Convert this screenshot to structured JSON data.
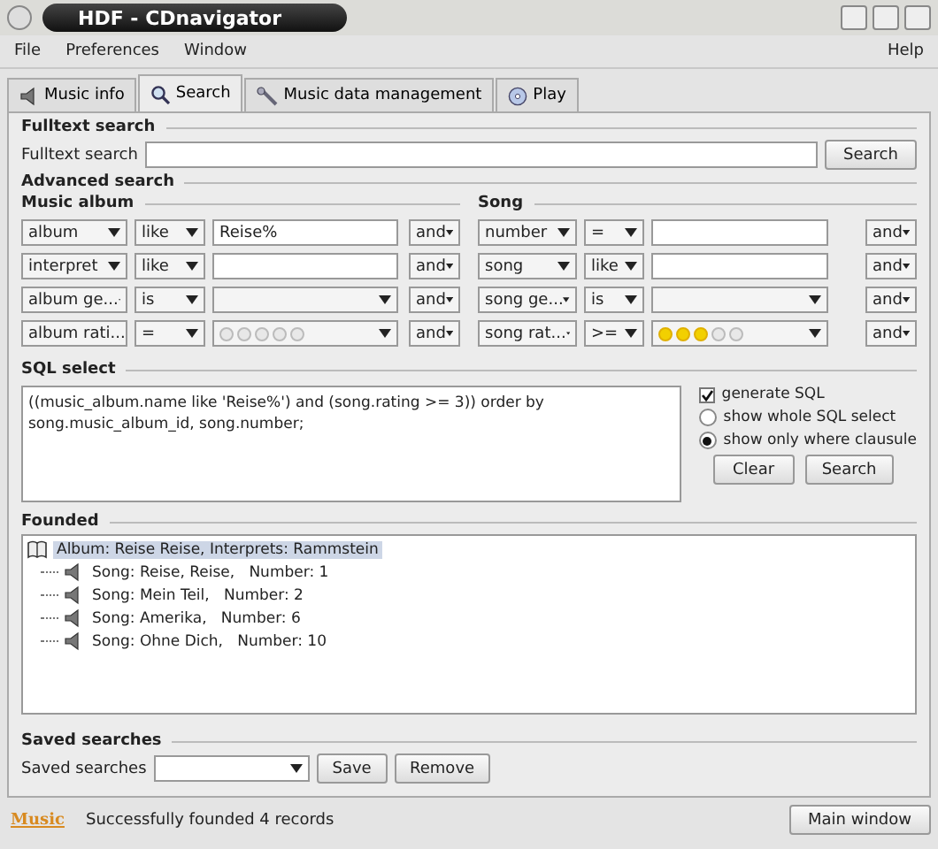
{
  "window": {
    "title": "HDF - CDnavigator"
  },
  "menu": {
    "left": [
      "File",
      "Preferences",
      "Window"
    ],
    "right": "Help"
  },
  "tabs": [
    {
      "label": "Music info",
      "selected": false,
      "kind": "speaker"
    },
    {
      "label": "Search",
      "selected": true,
      "kind": "search"
    },
    {
      "label": "Music data management",
      "selected": false,
      "kind": "wrench"
    },
    {
      "label": "Play",
      "selected": false,
      "kind": "disc"
    }
  ],
  "fulltext": {
    "heading": "Fulltext search",
    "label": "Fulltext search",
    "button": "Search"
  },
  "advanced": {
    "heading": "Advanced search",
    "groups": [
      {
        "heading": "Music album",
        "rows": [
          {
            "field": "album",
            "op": "like",
            "kind": "text",
            "value": "Reise%",
            "conj": "and"
          },
          {
            "field": "interpret",
            "op": "like",
            "kind": "text",
            "conj": "and"
          },
          {
            "field": "album ge...",
            "op": "is",
            "kind": "select",
            "conj": "and"
          },
          {
            "field": "album rati...",
            "op": "=",
            "kind": "rating",
            "stars": 0,
            "conj": "and"
          }
        ]
      },
      {
        "heading": "Song",
        "rows": [
          {
            "field": "number",
            "op": "=",
            "kind": "text",
            "conj": "and"
          },
          {
            "field": "song",
            "op": "like",
            "kind": "text",
            "conj": "and"
          },
          {
            "field": "song ge...",
            "op": "is",
            "kind": "select",
            "conj": "and"
          },
          {
            "field": "song rat...",
            "op": ">=",
            "kind": "rating",
            "stars": 3,
            "conj": "and"
          }
        ]
      }
    ]
  },
  "sql": {
    "heading": "SQL select",
    "text": "((music_album.name like 'Reise%') and (song.rating >= 3)) order by song.music_album_id, song.number;",
    "generate": {
      "label": "generate SQL",
      "checked": true
    },
    "modes": [
      {
        "label": "show whole SQL select",
        "selected": false
      },
      {
        "label": "show only where clausule",
        "selected": true
      }
    ],
    "buttons": [
      "Clear",
      "Search"
    ]
  },
  "founded": {
    "heading": "Founded",
    "tree": [
      {
        "label": "Album: Reise Reise, Interprets: Rammstein",
        "selected": true,
        "children": [
          {
            "label": "Song: Reise, Reise,   Number: 1",
            "selected": false
          },
          {
            "label": "Song: Mein Teil,   Number: 2",
            "selected": false
          },
          {
            "label": "Song: Amerika,   Number: 6",
            "selected": false
          },
          {
            "label": "Song: Ohne Dich,   Number: 10",
            "selected": false
          }
        ]
      }
    ]
  },
  "saved": {
    "heading": "Saved searches",
    "label": "Saved searches",
    "buttons": [
      "Save",
      "Remove"
    ]
  },
  "status_bar": {
    "logo": "Music",
    "message": "Successfully founded 4 records",
    "button": "Main window"
  }
}
